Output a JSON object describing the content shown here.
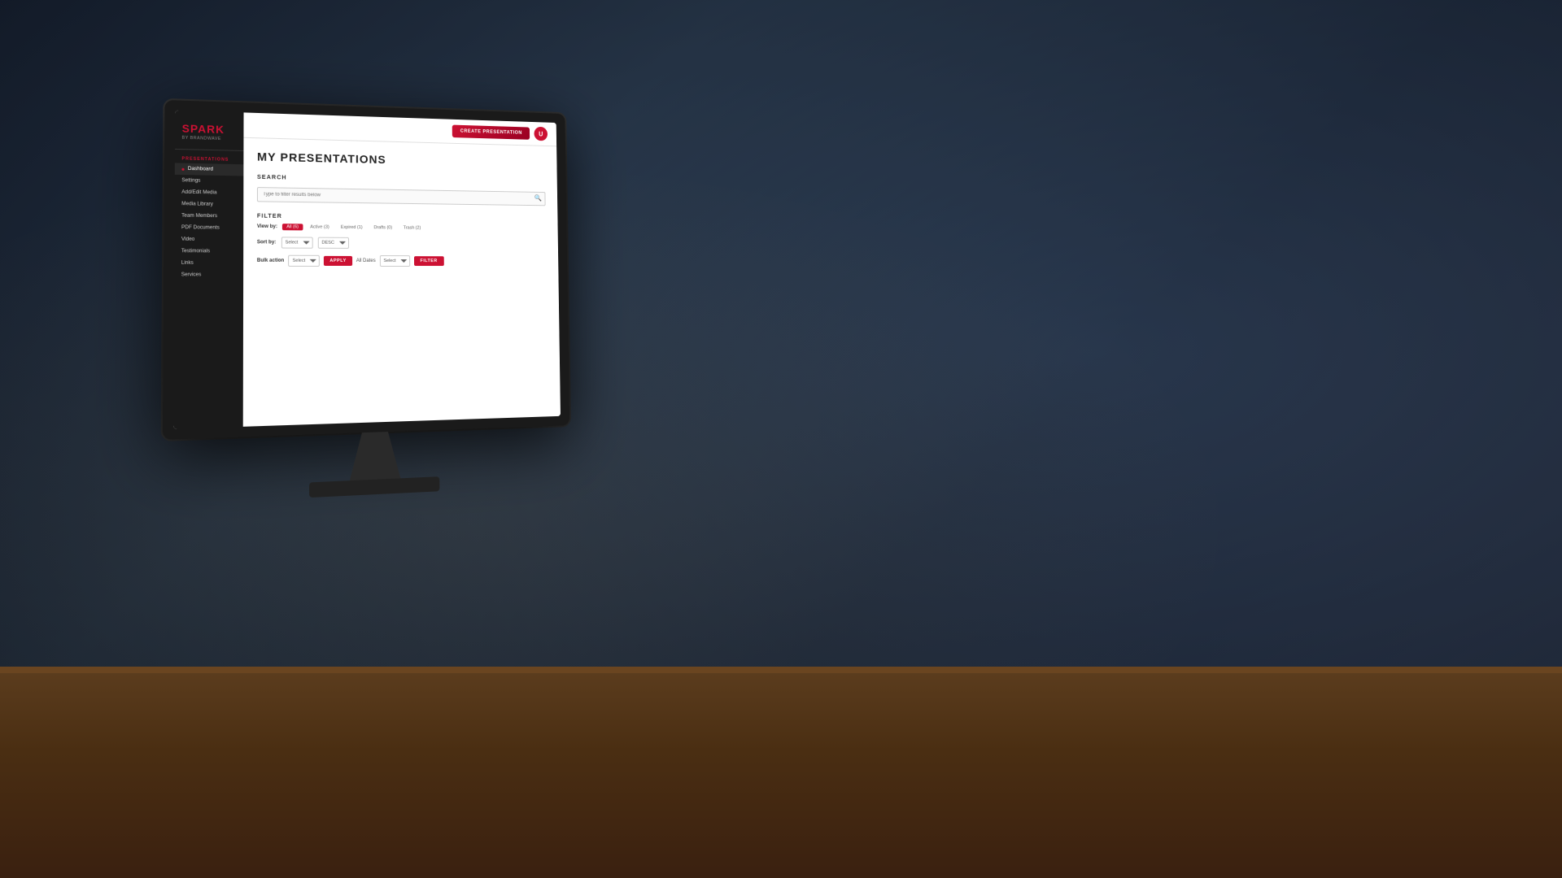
{
  "app": {
    "logo": {
      "main": "SP",
      "accent": "ARK",
      "sub": "BY BRANDWAVE"
    },
    "topbar": {
      "create_button_label": "CREATE PRESENTATION",
      "user_initial": "U"
    },
    "sidebar": {
      "section_label": "PRESENTATIONS",
      "items": [
        {
          "label": "Dashboard",
          "active": true
        },
        {
          "label": "Settings",
          "active": false
        },
        {
          "label": "Add/Edit Media",
          "active": false
        },
        {
          "label": "Media Library",
          "active": false
        },
        {
          "label": "Team Members",
          "active": false
        },
        {
          "label": "PDF Documents",
          "active": false
        },
        {
          "label": "Video",
          "active": false
        },
        {
          "label": "Testimonials",
          "active": false
        },
        {
          "label": "Links",
          "active": false
        },
        {
          "label": "Services",
          "active": false
        }
      ]
    },
    "main": {
      "page_title": "MY PRESENTATIONS",
      "search": {
        "label": "SEARCH",
        "placeholder": "Type to filter results below"
      },
      "filter": {
        "label": "FILTER",
        "view_by_label": "View by:",
        "tags": [
          {
            "label": "All (6)",
            "active": true
          },
          {
            "label": "Active (3)",
            "active": false
          },
          {
            "label": "Expired (1)",
            "active": false
          },
          {
            "label": "Drafts (0)",
            "active": false
          },
          {
            "label": "Trash (2)",
            "active": false
          }
        ]
      },
      "sort": {
        "label": "Sort by:",
        "select_placeholder": "Select",
        "order_placeholder": "DESC"
      },
      "bulk_action": {
        "label": "Bulk action",
        "select_placeholder": "Select",
        "apply_button": "APPLY",
        "all_dates_label": "All Dates",
        "date_select_placeholder": "Select",
        "filter_button": "FILTER"
      }
    }
  }
}
